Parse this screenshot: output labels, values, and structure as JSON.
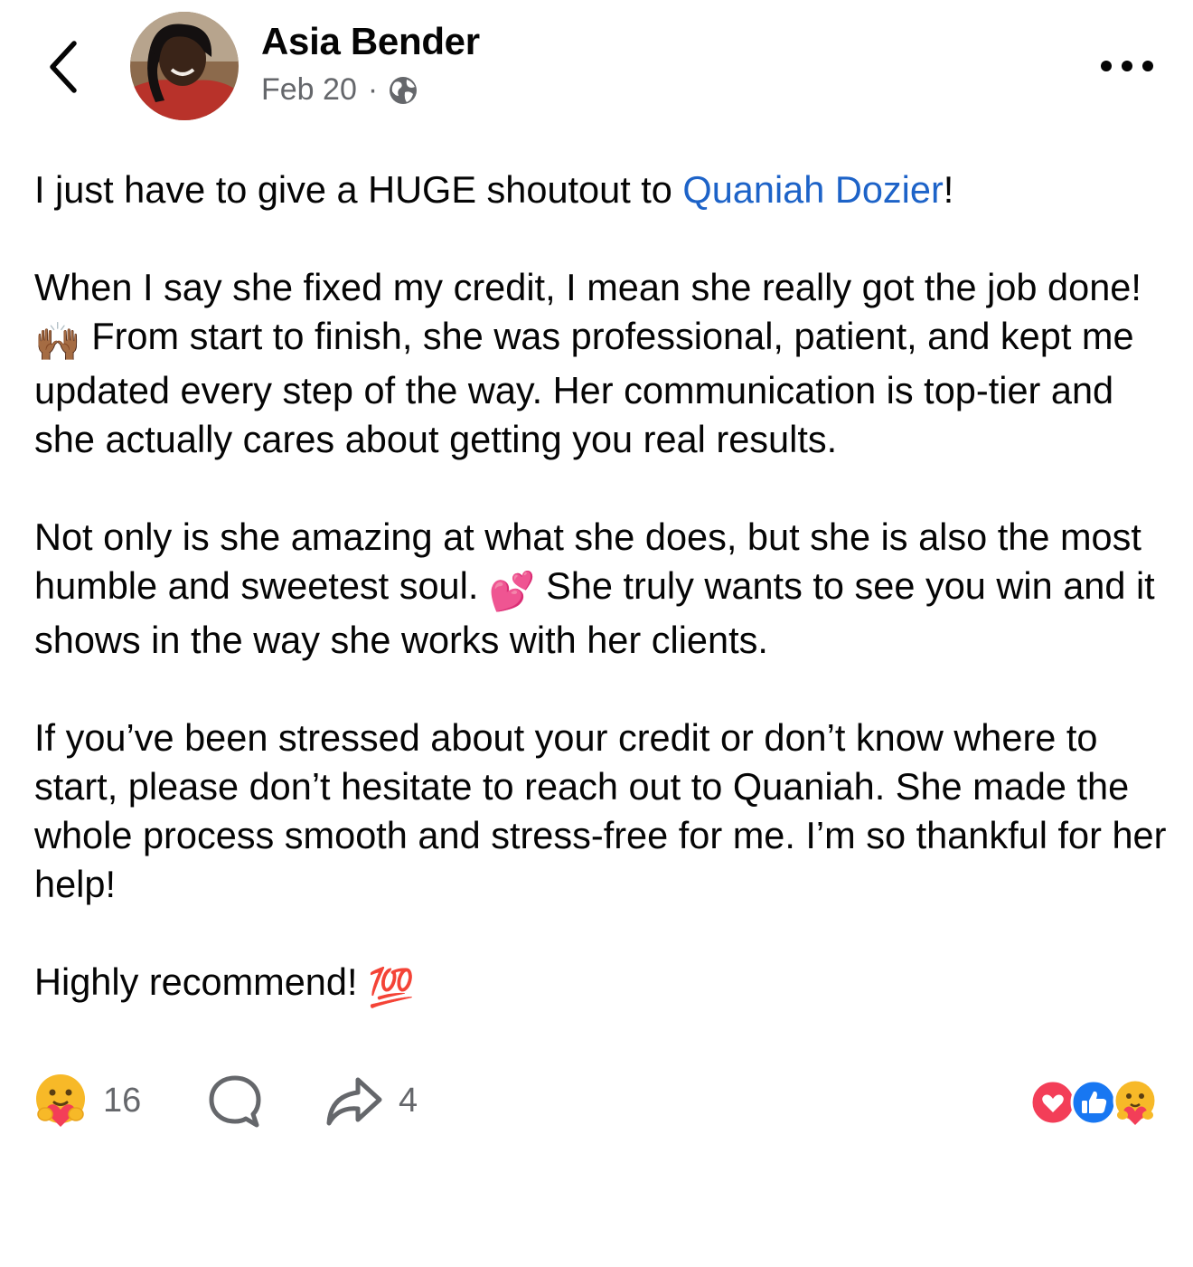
{
  "header": {
    "author_name": "Asia Bender",
    "post_date": "Feb 20",
    "separator": "·",
    "privacy_icon": "globe-icon",
    "back_icon": "chevron-left-icon",
    "more_icon": "more-options-icon"
  },
  "post": {
    "p1_prefix": "I just have to give a HUGE shoutout to ",
    "mention": "Quaniah Dozier",
    "p1_suffix": "!",
    "p2_a": "When I say she fixed my credit, I mean she really got the job done! ",
    "p2_emoji": "🙌🏾",
    "p2_b": " From start to finish, she was professional, patient, and kept me updated every step of the way. Her communication is top-tier and she actually cares about getting you real results.",
    "p3_a": "Not only is she amazing at what she does, but she is also the most humble and sweetest soul. ",
    "p3_emoji": "💕",
    "p3_b": " She truly wants to see you win and it shows in the way she works with her clients.",
    "p4": "If you’ve been stressed about your credit or don’t know where to start, please don’t hesitate to reach out to Quaniah. She made the whole process smooth and stress-free for me. I’m so thankful for her help!",
    "p5": "Highly recommend! ",
    "p5_emoji": "💯"
  },
  "footer": {
    "reaction_count": "16",
    "share_count": "4",
    "reaction_icons": [
      "love-reaction-icon",
      "like-reaction-icon",
      "care-reaction-icon"
    ]
  },
  "colors": {
    "mention": "#1d63c8",
    "secondary_text": "#65676b",
    "love": "#f33e58",
    "like": "#1877f2",
    "care": "#f7b928"
  }
}
